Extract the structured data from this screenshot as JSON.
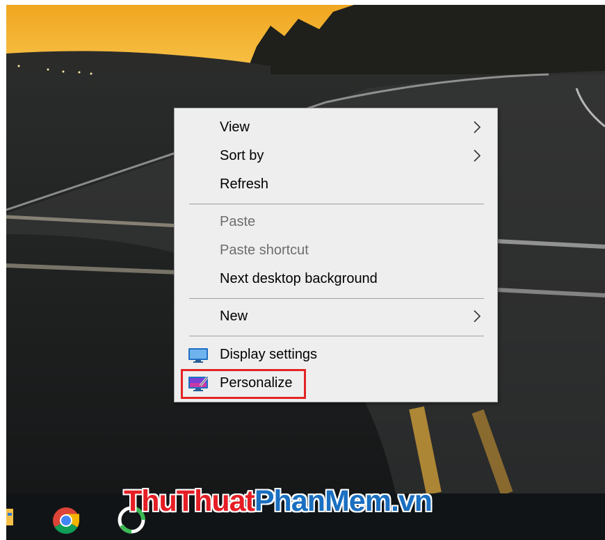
{
  "menu": {
    "items": [
      {
        "label": "View",
        "enabled": true,
        "submenu": true
      },
      {
        "label": "Sort by",
        "enabled": true,
        "submenu": true
      },
      {
        "label": "Refresh",
        "enabled": true,
        "submenu": false
      },
      {
        "label": "Paste",
        "enabled": false,
        "submenu": false
      },
      {
        "label": "Paste shortcut",
        "enabled": false,
        "submenu": false
      },
      {
        "label": "Next desktop background",
        "enabled": true,
        "submenu": false
      },
      {
        "label": "New",
        "enabled": true,
        "submenu": true
      },
      {
        "label": "Display settings",
        "enabled": true,
        "submenu": false,
        "icon": "display-settings-icon"
      },
      {
        "label": "Personalize",
        "enabled": true,
        "submenu": false,
        "icon": "personalize-icon",
        "highlighted": true
      }
    ]
  },
  "taskbar": {
    "icons": [
      "file-explorer-icon",
      "chrome-icon",
      "app-icon"
    ]
  },
  "watermark": {
    "part1": "ThuThuat",
    "part2": "PhanMem.vn"
  },
  "colors": {
    "menu_background": "#eeeeee",
    "highlight_border": "#e32424",
    "watermark_red": "#e51e25",
    "watermark_blue": "#1a6fc0",
    "taskbar": "#111416"
  }
}
